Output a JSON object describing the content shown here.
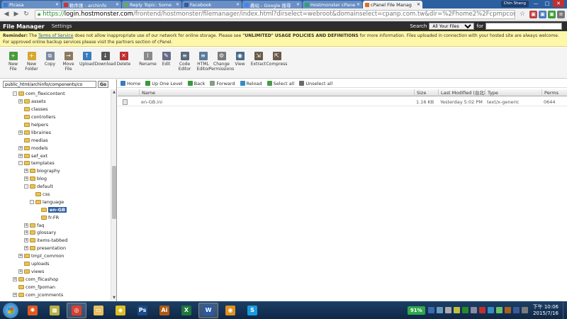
{
  "browser": {
    "tabs": [
      {
        "label": "Picasa",
        "color": "#3b7dd8",
        "active": false
      },
      {
        "label": "軟件匯 - archinfo",
        "color": "#c33",
        "active": false
      },
      {
        "label": "Reply Topic: Some",
        "color": "#6a6",
        "active": false
      },
      {
        "label": "Facebook",
        "color": "#3b5998",
        "active": false
      },
      {
        "label": "轟站 - Google 搜尋",
        "color": "#4285f4",
        "active": false
      },
      {
        "label": "Hostmonster cPanel",
        "color": "#2a6",
        "active": false
      },
      {
        "label": "cPanel File Manag",
        "color": "#e07020",
        "active": true
      }
    ],
    "user_name": "Chin Sheng",
    "url_scheme": "https://",
    "url_host": "login.hostmonster.com",
    "url_rest": "/frontend/hostmonster/filemanager/index.html?dirselect=webroot&domainselect=cpanp.com.tw&dir=%2Fhome2%2Fcpmpcom%2Fpubl",
    "back_glyph": "◀",
    "forward_glyph": "▶",
    "reload_glyph": "↻",
    "star_glyph": "☆",
    "minimize_glyph": "—",
    "maximize_glyph": "□",
    "close_glyph": "✕"
  },
  "file_manager": {
    "title": "File Manager",
    "settings_label": "Settings",
    "search_label": "Search",
    "search_scope": "All Your Files",
    "for_label": "for",
    "search_value": ""
  },
  "reminder": {
    "prefix": "Reminder:",
    "text_1": " The ",
    "tos_link": "Terms of Service",
    "text_2": " does not allow inappropriate use of our network for online storage. Please see ",
    "policy": "\"UNLIMITED\" USAGE POLICIES AND DEFINITIONS",
    "text_3": " for more information. Files uploaded in connection with your hosted site are always welcome. For approved online backup services please visit the partners section of cPanel."
  },
  "toolbar": {
    "buttons": [
      {
        "label": "New File",
        "icon": "new-file-icon",
        "color": "#4a9a3a",
        "glyph": "+"
      },
      {
        "label": "New Folder",
        "icon": "new-folder-icon",
        "color": "#d6a830",
        "glyph": "+"
      },
      {
        "label": "Copy",
        "icon": "copy-icon",
        "color": "#7a8aa0",
        "glyph": "⧉"
      },
      {
        "label": "Move File",
        "icon": "move-file-icon",
        "color": "#8a7a60",
        "glyph": "→"
      },
      {
        "label": "Upload",
        "icon": "upload-icon",
        "color": "#3a7ac0",
        "glyph": "↑"
      },
      {
        "label": "Download",
        "icon": "download-icon",
        "color": "#555555",
        "glyph": "↓"
      },
      {
        "label": "Delete",
        "icon": "delete-icon",
        "color": "#c03030",
        "glyph": "✕"
      },
      {
        "label": "Rename",
        "icon": "rename-icon",
        "color": "#8a8a8a",
        "glyph": "I"
      },
      {
        "label": "Edit",
        "icon": "edit-icon",
        "color": "#6a6a8a",
        "glyph": "✎"
      },
      {
        "label": "Code Editor",
        "icon": "code-editor-icon",
        "color": "#5a6a7a",
        "glyph": "≡"
      },
      {
        "label": "HTML Editor",
        "icon": "html-editor-icon",
        "color": "#5a7a9a",
        "glyph": "≡"
      },
      {
        "label": "Change Permissions",
        "icon": "change-permissions-icon",
        "color": "#7a7a7a",
        "glyph": "⚙"
      },
      {
        "label": "View",
        "icon": "view-icon",
        "color": "#4a6a8a",
        "glyph": "◉"
      },
      {
        "label": "Extract",
        "icon": "extract-icon",
        "color": "#6a5a4a",
        "glyph": "⇲"
      },
      {
        "label": "Compress",
        "icon": "compress-icon",
        "color": "#6a5a4a",
        "glyph": "⇱"
      }
    ]
  },
  "tree": {
    "path_value": "public_html/archinfo/components/co",
    "go_label": "Go",
    "nodes": [
      {
        "label": "com_flexicontent",
        "depth": 3,
        "pm": "-",
        "selected": false
      },
      {
        "label": "assets",
        "depth": 4,
        "pm": "+",
        "selected": false
      },
      {
        "label": "classes",
        "depth": 4,
        "pm": "",
        "selected": false
      },
      {
        "label": "controllers",
        "depth": 4,
        "pm": "",
        "selected": false
      },
      {
        "label": "helpers",
        "depth": 4,
        "pm": "",
        "selected": false
      },
      {
        "label": "librairies",
        "depth": 4,
        "pm": "+",
        "selected": false
      },
      {
        "label": "medias",
        "depth": 4,
        "pm": "",
        "selected": false
      },
      {
        "label": "models",
        "depth": 4,
        "pm": "+",
        "selected": false
      },
      {
        "label": "sef_ext",
        "depth": 4,
        "pm": "+",
        "selected": false
      },
      {
        "label": "templates",
        "depth": 4,
        "pm": "-",
        "selected": false
      },
      {
        "label": "biography",
        "depth": 5,
        "pm": "+",
        "selected": false
      },
      {
        "label": "blog",
        "depth": 5,
        "pm": "+",
        "selected": false
      },
      {
        "label": "default",
        "depth": 5,
        "pm": "-",
        "selected": false
      },
      {
        "label": "css",
        "depth": 6,
        "pm": "",
        "selected": false
      },
      {
        "label": "language",
        "depth": 6,
        "pm": "-",
        "selected": false
      },
      {
        "label": "en-GB",
        "depth": 7,
        "pm": "",
        "selected": true
      },
      {
        "label": "fr-FR",
        "depth": 7,
        "pm": "",
        "selected": false
      },
      {
        "label": "faq",
        "depth": 5,
        "pm": "+",
        "selected": false
      },
      {
        "label": "glossary",
        "depth": 5,
        "pm": "+",
        "selected": false
      },
      {
        "label": "items-tabbed",
        "depth": 5,
        "pm": "+",
        "selected": false
      },
      {
        "label": "presentation",
        "depth": 5,
        "pm": "+",
        "selected": false
      },
      {
        "label": "tmpl_common",
        "depth": 4,
        "pm": "+",
        "selected": false
      },
      {
        "label": "uploads",
        "depth": 4,
        "pm": "",
        "selected": false
      },
      {
        "label": "views",
        "depth": 4,
        "pm": "+",
        "selected": false
      },
      {
        "label": "com_flicashop",
        "depth": 3,
        "pm": "+",
        "selected": false
      },
      {
        "label": "com_fpoman",
        "depth": 3,
        "pm": "",
        "selected": false
      },
      {
        "label": "com_jcomments",
        "depth": 3,
        "pm": "+",
        "selected": false
      }
    ]
  },
  "nav": {
    "items": [
      {
        "label": "Home",
        "icon": "home-icon",
        "color": "#3a7ac0"
      },
      {
        "label": "Up One Level",
        "icon": "up-level-icon",
        "color": "#3a9a3a"
      },
      {
        "label": "Back",
        "icon": "back-icon",
        "color": "#3a9a3a"
      },
      {
        "label": "Forward",
        "icon": "forward-icon",
        "color": "#8a9a8a"
      },
      {
        "label": "Reload",
        "icon": "reload-icon",
        "color": "#3a8ac0"
      },
      {
        "label": "Select all",
        "icon": "select-all-icon",
        "color": "#4a9a4a"
      },
      {
        "label": "Unselect all",
        "icon": "unselect-all-icon",
        "color": "#6a6a6a"
      }
    ]
  },
  "table": {
    "headers": {
      "name": "Name",
      "size": "Size",
      "modified": "Last Modified (台北標",
      "type": "Type",
      "perms": "Perms"
    },
    "rows": [
      {
        "name": "en-GB.ini",
        "size": "1.16 KB",
        "modified": "Yesterday 5:02 PM",
        "type": "text/x-generic",
        "perms": "0644"
      }
    ]
  },
  "taskbar": {
    "apps": [
      {
        "name": "xampp",
        "color": "#e05a20",
        "glyph": "✱",
        "active": false
      },
      {
        "name": "app-yellow",
        "color": "#b8b040",
        "glyph": "▦",
        "active": false
      },
      {
        "name": "chrome",
        "color": "#d84030",
        "glyph": "◎",
        "active": true
      },
      {
        "name": "explorer",
        "color": "#e8c060",
        "glyph": "▭",
        "active": false
      },
      {
        "name": "app-diamond",
        "color": "#e0c020",
        "glyph": "◆",
        "active": false
      },
      {
        "name": "photoshop",
        "color": "#1a4a8a",
        "glyph": "Ps",
        "active": false
      },
      {
        "name": "illustrator",
        "color": "#b05a10",
        "glyph": "Ai",
        "active": false
      },
      {
        "name": "excel",
        "color": "#1e7a3a",
        "glyph": "X",
        "active": false
      },
      {
        "name": "word",
        "color": "#2a5aa8",
        "glyph": "W",
        "active": true
      },
      {
        "name": "app-orange",
        "color": "#e09020",
        "glyph": "◉",
        "active": false
      },
      {
        "name": "skype",
        "color": "#1a9ae0",
        "glyph": "S",
        "active": false
      }
    ],
    "battery": "91%",
    "time": "下午 10:06",
    "date": "2015/7/16",
    "tray_colors": [
      "#3a6ab0",
      "#6a9ac0",
      "#aaaaaa",
      "#c0c040",
      "#2a8a2a",
      "#8a8aa0",
      "#c03030",
      "#3a8ac0",
      "#6ac06a",
      "#aa6020",
      "#3a5a9a",
      "#7a7a7a"
    ]
  }
}
